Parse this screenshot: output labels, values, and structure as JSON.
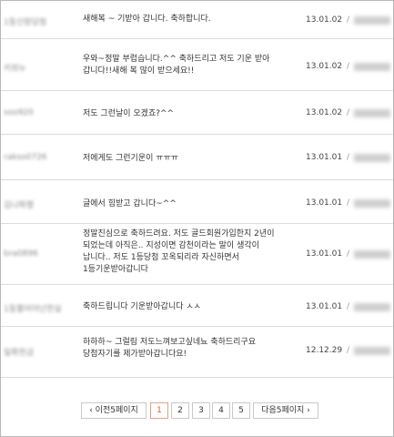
{
  "comments": [
    {
      "nickname": "1등신랑당첨",
      "message": "새해복 ~ 기받아 갑니다. 축하합니다.",
      "date": "13.01.02"
    },
    {
      "nickname": "키위누",
      "message": "우와~정말 부럽습니다.^^ 축하드리고 저도 기운 받아 갑니다!!새해 복 많이 받으세요!!",
      "date": "13.01.02"
    },
    {
      "nickname": "soo920",
      "message": "저도 그런날이 오겠죠?^^",
      "date": "13.01.02"
    },
    {
      "nickname": "rakso0726",
      "message": "저에게도 그런기운이 ㅠㅠㅠ",
      "date": "13.01.01"
    },
    {
      "nickname": "김나화평",
      "message": "글에서 힘받고 갑니다~^^",
      "date": "13.01.01"
    },
    {
      "nickname": "bra0896",
      "message": "정말진심으로 축하드려요. 저도 골드회원가입한지 2년이 되었는데 아직은.. 지성이면 감천이라는 말이 생각이 납니다.. 저도 1등당첨 꼬옥되리라 자신하면서 1등기운받아갑니다",
      "date": "13.01.01"
    },
    {
      "nickname": "1등불어어넌천실",
      "message": "축하드립니다 기운받아갑니다 ㅅㅅ",
      "date": "13.01.01"
    },
    {
      "nickname": "일확천금",
      "message": "하하하~ 그럴림 저도느껴보고싶네뇨 축하드리구요 당첨자기를 제가받아갑니다요!",
      "date": "12.12.29"
    }
  ],
  "separator": "/",
  "pagination": {
    "prev_label": "‹ 이전5페이지",
    "pages": [
      "1",
      "2",
      "3",
      "4",
      "5"
    ],
    "current": "1",
    "next_label": "다음5페이지 ›"
  },
  "colors": {
    "current_page": "#e1592b",
    "row_divider": "#dcdcdc",
    "frame_border": "#b9b9b9"
  }
}
